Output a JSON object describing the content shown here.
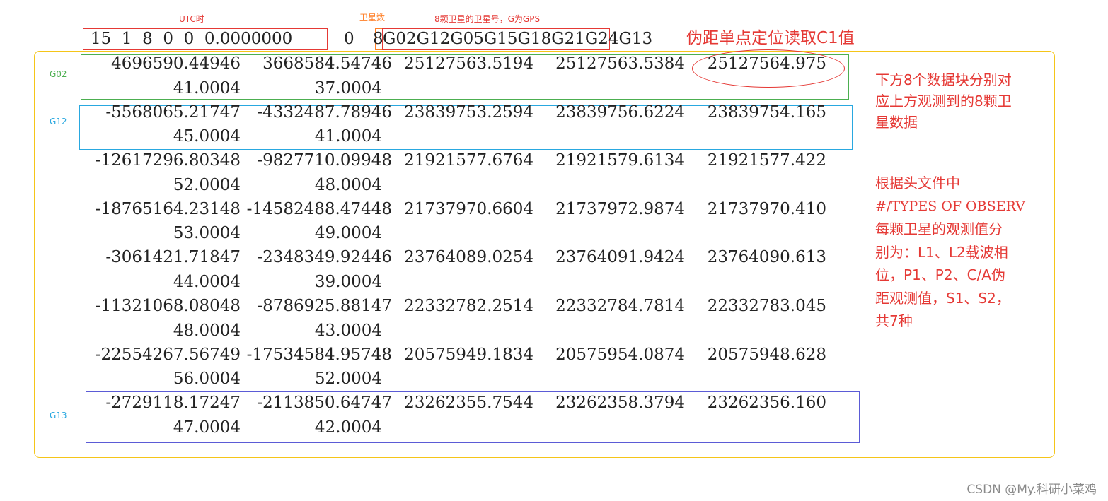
{
  "labels": {
    "utc_label": "UTC时",
    "sat_count_label": "卫星数",
    "sat_ids_label": "8颗卫星的卫星号，G为GPS",
    "c1_note": "伪距单点定位读取C1值"
  },
  "header": {
    "time_fields": "15  1  8  0  0  0.0000000",
    "flag": "0",
    "sat_count": "8",
    "sat_ids": "G02G12G05G15G18G21G24G13"
  },
  "notes": {
    "blocks_note": [
      "下方8个数据块分别对",
      "应上方观测到的8颗卫",
      "星数据"
    ],
    "types_note": [
      "根据头文件中",
      "#/TYPES OF OBSERV",
      "每颗卫星的观测值分",
      "别为：L1、L2载波相",
      "位，P1、P2、C/A伪",
      "距观测值，S1、S2，",
      "共7种"
    ]
  },
  "sat_tags": {
    "g02": "G02",
    "g12": "G12",
    "g13": "G13"
  },
  "colors": {
    "red": "#e53935",
    "orange": "#ff7f27",
    "yellow": "#f5c518",
    "green": "#4caf50",
    "cyan": "#29a8e0",
    "purple": "#5b5bd6"
  },
  "rows": [
    {
      "c1": "4696590.44946",
      "c2": "3668584.54746",
      "c3": "25127563.5194",
      "c4": "25127563.5384",
      "c5": "25127564.975",
      "s1": "41.0004",
      "s2": "37.0004"
    },
    {
      "c1": "-5568065.21747",
      "c2": "-4332487.78946",
      "c3": "23839753.2594",
      "c4": "23839756.6224",
      "c5": "23839754.165",
      "s1": "45.0004",
      "s2": "41.0004"
    },
    {
      "c1": "-12617296.80348",
      "c2": "-9827710.09948",
      "c3": "21921577.6764",
      "c4": "21921579.6134",
      "c5": "21921577.422",
      "s1": "52.0004",
      "s2": "48.0004"
    },
    {
      "c1": "-18765164.23148",
      "c2": "-14582488.47448",
      "c3": "21737970.6604",
      "c4": "21737972.9874",
      "c5": "21737970.410",
      "s1": "53.0004",
      "s2": "49.0004"
    },
    {
      "c1": "-3061421.71847",
      "c2": "-2348349.92446",
      "c3": "23764089.0254",
      "c4": "23764091.9424",
      "c5": "23764090.613",
      "s1": "44.0004",
      "s2": "39.0004"
    },
    {
      "c1": "-11321068.08048",
      "c2": "-8786925.88147",
      "c3": "22332782.2514",
      "c4": "22332784.7814",
      "c5": "22332783.045",
      "s1": "48.0004",
      "s2": "43.0004"
    },
    {
      "c1": "-22554267.56749",
      "c2": "-17534584.95748",
      "c3": "20575949.1834",
      "c4": "20575954.0874",
      "c5": "20575948.628",
      "s1": "56.0004",
      "s2": "52.0004"
    },
    {
      "c1": "-2729118.17247",
      "c2": "-2113850.64747",
      "c3": "23262355.7544",
      "c4": "23262358.3794",
      "c5": "23262356.160",
      "s1": "47.0004",
      "s2": "42.0004"
    }
  ],
  "watermark": "CSDN @My.科研小菜鸡"
}
